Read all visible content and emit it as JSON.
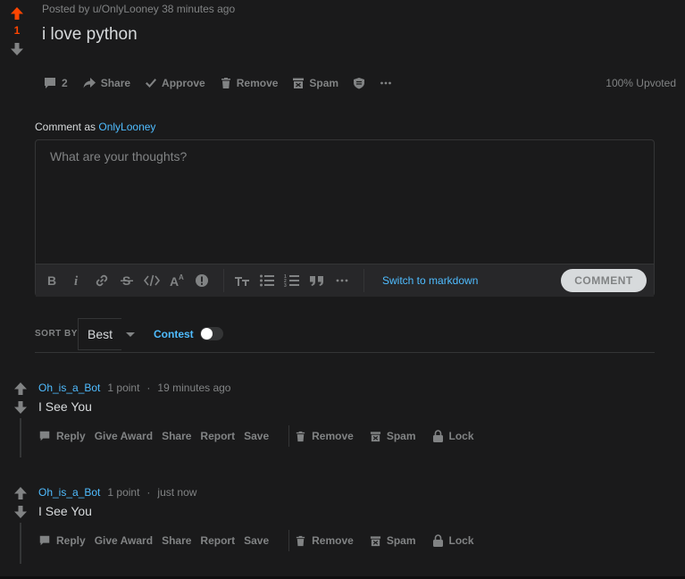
{
  "colors": {
    "accent": "#4fbcff",
    "upvote": "#ff4500",
    "background": "#1a1a1b",
    "muted": "#818384",
    "text": "#d7dadc"
  },
  "post": {
    "meta": "Posted by u/OnlyLooney 38 minutes ago",
    "title": "i love python",
    "score": "1",
    "actions": {
      "comments": "2",
      "share": "Share",
      "approve": "Approve",
      "remove": "Remove",
      "spam": "Spam"
    },
    "upvoted": "100% Upvoted"
  },
  "composer": {
    "comment_as_label": "Comment as",
    "username": "OnlyLooney",
    "placeholder": "What are your thoughts?",
    "switch_markdown": "Switch to markdown",
    "submit_label": "COMMENT",
    "toolbar_icons": [
      "bold-icon",
      "italic-icon",
      "link-icon",
      "strikethrough-icon",
      "inline-code-icon",
      "superscript-icon",
      "spoiler-icon",
      "heading-icon",
      "bulleted-list-icon",
      "numbered-list-icon",
      "quote-block-icon",
      "more-icon"
    ]
  },
  "sort": {
    "label": "SORT BY",
    "value": "Best",
    "contest": "Contest",
    "contest_enabled": false
  },
  "comments": [
    {
      "author": "Oh_is_a_Bot",
      "points": "1 point",
      "sep": "·",
      "time": "19 minutes ago",
      "body": "I See You",
      "actions": {
        "reply": "Reply",
        "award": "Give Award",
        "share": "Share",
        "report": "Report",
        "save": "Save",
        "remove": "Remove",
        "spam": "Spam",
        "lock": "Lock"
      }
    },
    {
      "author": "Oh_is_a_Bot",
      "points": "1 point",
      "sep": "·",
      "time": "just now",
      "body": "I See You",
      "actions": {
        "reply": "Reply",
        "award": "Give Award",
        "share": "Share",
        "report": "Report",
        "save": "Save",
        "remove": "Remove",
        "spam": "Spam",
        "lock": "Lock"
      }
    }
  ]
}
